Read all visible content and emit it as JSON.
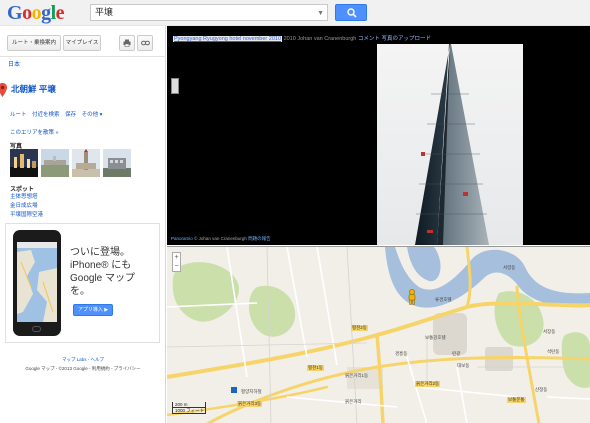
{
  "header": {
    "logo_text": "Google",
    "search_value": "平壌",
    "search_icon": "search-icon"
  },
  "panel": {
    "route_label": "ルート・乗換案内",
    "myplaces_label": "マイプレイス",
    "country_link": "日本",
    "place_title": "北朝鮮 平壌",
    "actions": [
      "ルート",
      "付近を検索",
      "保存",
      "その他 ▾"
    ],
    "explore_link": "このエリアを散策 »",
    "photos_label": "写真",
    "spots_label": "スポット",
    "spots": [
      "主体思想塔",
      "金日成広場",
      "平壌国際空港"
    ],
    "promo": {
      "line1": "ついに登場。",
      "line2": "iPhone® にも",
      "line3": "Google マップ",
      "line4": "を。",
      "button": "アプリ導入 ▶"
    },
    "footer_links": "マップ Labs - ヘルプ",
    "footer_copy": "Google マップ - ©2013 Google - 利用規約 - プライバシー"
  },
  "streetview": {
    "photo_title": "Pyongyang Ryugyong hotel november 2010",
    "photo_date": "2010",
    "author": "Johan van Cranenburgh",
    "comment": "コメント",
    "upload": "写真のアップロード",
    "footer_brand": "Panoramio",
    "footer_author": "© Johan van Cranenburgh",
    "footer_report": "問題の報告"
  },
  "map": {
    "labels": [
      "서령동",
      "경흥동",
      "붉은거리1동",
      "련광",
      "붉은거리",
      "대보동",
      "보통강호텔",
      "류경호텔",
      "평양지하철",
      "서장동",
      "석탄동",
      "산정동"
    ],
    "road_labels": [
      "평천1동",
      "평천2동",
      "붉은거리3동",
      "붉은거리2동",
      "보통문통"
    ],
    "scale_metric": "200 m",
    "scale_imperial": "1000 フィート"
  },
  "colors": {
    "accent": "#4d90fe",
    "link": "#1155cc",
    "road": "#f7d469",
    "water": "#a5bfdd",
    "park": "#cadfaa"
  }
}
